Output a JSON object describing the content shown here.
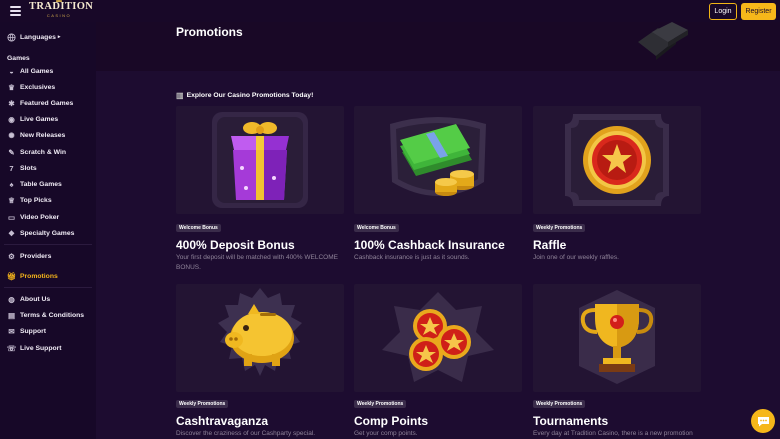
{
  "app": {
    "logo_text": "TRADITION",
    "logo_sub": "CASINO",
    "login_label": "Login",
    "register_label": "Register"
  },
  "sidebar": {
    "languages": "Languages",
    "games_heading": "Games",
    "items": [
      {
        "label": "All Games",
        "icon": "controller-icon"
      },
      {
        "label": "Exclusives",
        "icon": "crown-icon"
      },
      {
        "label": "Featured Games",
        "icon": "featured-icon"
      },
      {
        "label": "Live Games",
        "icon": "live-icon"
      },
      {
        "label": "New Releases",
        "icon": "new-icon"
      },
      {
        "label": "Scratch & Win",
        "icon": "scratch-icon"
      },
      {
        "label": "Slots",
        "icon": "slot-seven-icon"
      },
      {
        "label": "Table Games",
        "icon": "cards-icon"
      },
      {
        "label": "Top Picks",
        "icon": "trophy-icon"
      },
      {
        "label": "Video Poker",
        "icon": "monitor-icon"
      },
      {
        "label": "Specialty Games",
        "icon": "specialty-icon"
      }
    ],
    "providers": "Providers",
    "promotions": "Promotions",
    "bottom": [
      {
        "label": "About Us",
        "icon": "globe-icon"
      },
      {
        "label": "Terms & Conditions",
        "icon": "document-icon"
      },
      {
        "label": "Support",
        "icon": "envelope-icon"
      },
      {
        "label": "Live Support",
        "icon": "chat-icon"
      }
    ]
  },
  "main": {
    "title": "Promotions",
    "explore": "Explore Our Casino Promotions Today!",
    "cards": [
      {
        "badge": "Welcome Bonus",
        "title": "400% Deposit Bonus",
        "desc": "Your first deposit will be matched with 400% WELCOME BONUS.",
        "icon": "gift-box-icon"
      },
      {
        "badge": "Welcome Bonus",
        "title": "100% Cashback Insurance",
        "desc": "Cashback insurance is just as it sounds.",
        "icon": "cash-stack-icon"
      },
      {
        "badge": "Weekly Promotions",
        "title": "Raffle",
        "desc": "Join one of our weekly raffles.",
        "icon": "raffle-ticket-icon"
      },
      {
        "badge": "Weekly Promotions",
        "title": "Cashtravaganza",
        "desc": "Discover the craziness of our Cashparty special.",
        "icon": "piggy-bank-icon"
      },
      {
        "badge": "Weekly Promotions",
        "title": "Comp Points",
        "desc": "Get your comp points.",
        "icon": "star-coins-icon"
      },
      {
        "badge": "Weekly Promotions",
        "title": "Tournaments",
        "desc": "Every day at Tradition Casino, there is a new promotion",
        "icon": "trophy-cup-icon"
      }
    ]
  },
  "colors": {
    "accent": "#f6b71a",
    "background": "#1d0c30",
    "sidebar": "#170828",
    "card": "#231433"
  }
}
